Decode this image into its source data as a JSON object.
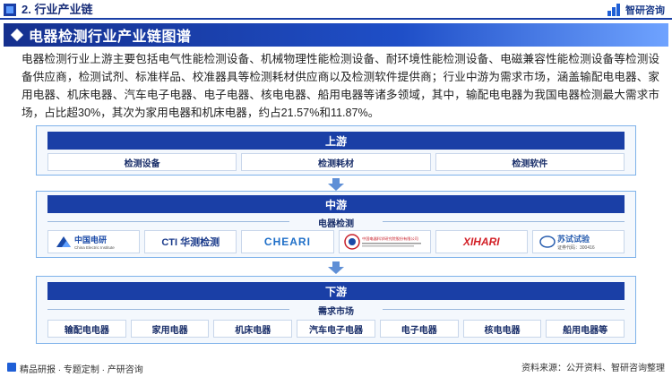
{
  "header": {
    "section_title": "2. 行业产业链",
    "brand": "智研咨询"
  },
  "title": "电器检测行业产业链图谱",
  "intro": "电器检测行业上游主要包括电气性能检测设备、机械物理性能检测设备、耐环境性能检测设备、电磁兼容性能检测设备等检测设备供应商，检测试剂、标准样品、校准器具等检测耗材供应商以及检测软件提供商；行业中游为需求市场，涵盖输配电电器、家用电器、机床电器、汽车电子电器、电子电器、核电电器、船用电器等诸多领域，其中，输配电电器为我国电器检测最大需求市场，占比超30%，其次为家用电器和机床电器，约占21.57%和11.87%。",
  "upstream": {
    "label": "上游",
    "items": [
      "检测设备",
      "检测耗材",
      "检测软件"
    ]
  },
  "midstream": {
    "label": "中游",
    "sub_label": "电器检测",
    "logos": [
      {
        "name": "china-electric-institute-logo",
        "text": "中国电研",
        "sub": "China Electric Institute",
        "color": "#1a4aa8"
      },
      {
        "name": "cti-logo",
        "text": "CTI 华测检测",
        "sub": "",
        "color": "#1a3a8a"
      },
      {
        "name": "chenari-logo",
        "text": "CHEARI",
        "sub": "",
        "color": "#1f6fc8"
      },
      {
        "name": "research-institute-logo",
        "text": "中国电器科学研究院股份有限公司",
        "sub": "",
        "color": "#c8202a"
      },
      {
        "name": "xihari-logo",
        "text": "XIHARI",
        "sub": "",
        "color": "#d21f26"
      },
      {
        "name": "sushi-testing-logo",
        "text": "苏试试验",
        "sub": "证券代码：300416",
        "color": "#2a5fb0"
      }
    ]
  },
  "downstream": {
    "label": "下游",
    "sub_label": "需求市场",
    "items": [
      "输配电电器",
      "家用电器",
      "机床电器",
      "汽车电子电器",
      "电子电器",
      "核电电器",
      "船用电器等"
    ]
  },
  "footer": {
    "left": "精品研报 · 专题定制 · 产研咨询",
    "right": "资料来源：公开资料、智研咨询整理"
  },
  "colors": {
    "primary": "#1a3fa6",
    "panel_border": "#7eb2ea",
    "panel_bg": "#f4f8fd"
  }
}
